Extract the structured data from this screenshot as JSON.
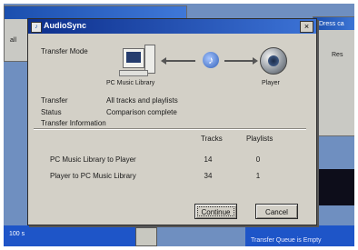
{
  "dialog": {
    "title": "AudioSync",
    "close_glyph": "×",
    "icon_glyph": "♪",
    "transfer_mode_label": "Transfer Mode",
    "source_label": "PC Music Library",
    "target_label": "Player",
    "transfer_label": "Transfer",
    "transfer_value": "All tracks and playlists",
    "status_label": "Status",
    "status_value": "Comparison complete",
    "info_label": "Transfer Information",
    "table": {
      "headers": [
        "Tracks",
        "Playlists"
      ],
      "rows": [
        {
          "label": "PC Music Library to Player",
          "tracks": "14",
          "playlists": "0"
        },
        {
          "label": "Player to PC Music Library",
          "tracks": "34",
          "playlists": "1"
        }
      ]
    },
    "buttons": {
      "continue": "Continue",
      "cancel": "Cancel"
    },
    "icons": {
      "pc": "computer-icon",
      "transfer": "music-note-icon",
      "player": "media-player-icon"
    }
  },
  "background": {
    "window_text_left": "all",
    "window_text_right_top": "Dress ca",
    "window_text_right_mid": "Res",
    "counter_text": "100 s",
    "taskbar_tip": "Transfer Queue is Empty"
  }
}
